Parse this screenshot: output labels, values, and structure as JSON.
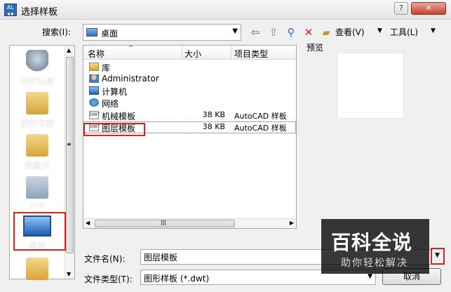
{
  "window": {
    "title": "选择样板",
    "app_icon_text": "AL\n□□",
    "help_label": "?",
    "close_label": "✕"
  },
  "toolbar": {
    "lookin_label": "搜索(I):",
    "lookin_value": "桌面",
    "views_label": "查看(V)",
    "tools_label": "工具(L)",
    "icons": [
      "back-icon",
      "up-folder-icon",
      "search-web-icon",
      "delete-icon",
      "new-folder-icon"
    ]
  },
  "places": [
    {
      "label": "历史记录",
      "icon": "history-icon"
    },
    {
      "label": "我的文档",
      "icon": "documents-icon"
    },
    {
      "label": "收藏夹",
      "icon": "favorites-icon"
    },
    {
      "label": "FTP",
      "icon": "ftp-icon"
    },
    {
      "label": "桌面",
      "icon": "desktop-icon"
    },
    {
      "label": "",
      "icon": "folder-icon"
    }
  ],
  "file_list": {
    "columns": [
      "名称",
      "大小",
      "项目类型"
    ],
    "rows": [
      {
        "name": "库",
        "size": "",
        "type": "",
        "icon": "library-icon"
      },
      {
        "name": "Administrator",
        "size": "",
        "type": "",
        "icon": "user-folder-icon"
      },
      {
        "name": "计算机",
        "size": "",
        "type": "",
        "icon": "computer-icon"
      },
      {
        "name": "网络",
        "size": "",
        "type": "",
        "icon": "network-icon"
      },
      {
        "name": "机械模板",
        "size": "38 KB",
        "type": "AutoCAD 样板",
        "icon": "dwt-file-icon"
      },
      {
        "name": "图层模板",
        "size": "38 KB",
        "type": "AutoCAD 样板",
        "icon": "dwt-file-icon"
      }
    ],
    "selected_row": "图层模板"
  },
  "preview": {
    "label": "预览"
  },
  "form": {
    "filename_label": "文件名(N):",
    "filename_value": "图层模板",
    "filetype_label": "文件类型(T):",
    "filetype_value": "图形样板 (*.dwt)",
    "cancel_label": "取消"
  },
  "watermark": {
    "logo": "百科全说",
    "subtitle": "助你轻松解决"
  },
  "colors": {
    "highlight_border": "#e02020",
    "accent": "#2d6db5"
  }
}
